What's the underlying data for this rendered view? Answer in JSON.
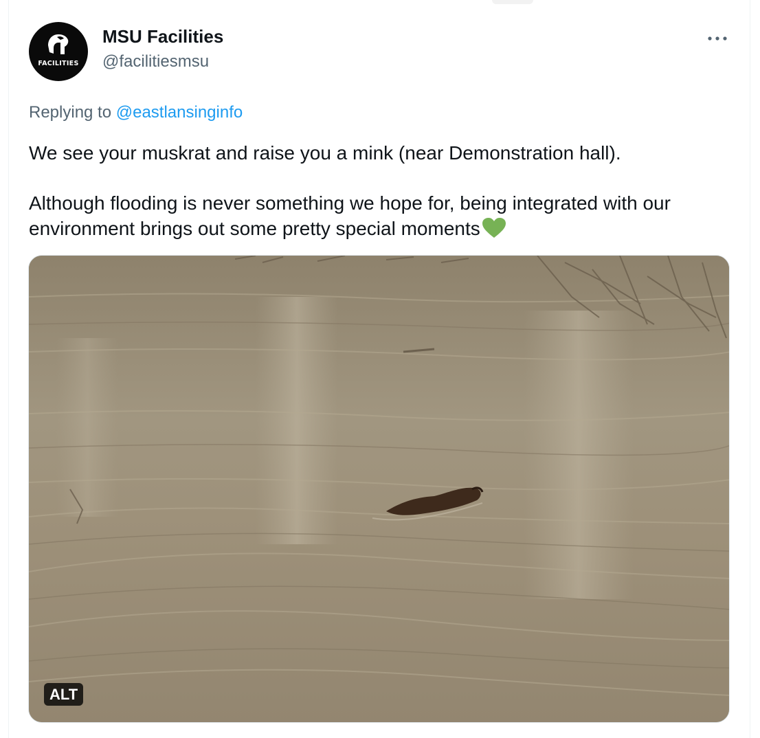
{
  "tweet": {
    "author": {
      "display_name": "MSU Facilities",
      "handle": "@facilitiesmsu",
      "avatar_text": "FACILITIES"
    },
    "more_icon": "more-dots-icon",
    "reply": {
      "prefix": "Replying to ",
      "to": "@eastlansinginfo"
    },
    "text_paragraphs": [
      "We see your muskrat and raise you a mink (near Demonstration hall).",
      "Although flooding is never something we hope for, being integrated with our environment brings out some pretty special moments"
    ],
    "emoji": "green-heart-icon",
    "media": {
      "alt_badge": "ALT"
    }
  },
  "colors": {
    "link": "#1d9bf0",
    "secondary_text": "#536471",
    "primary_text": "#0f1419",
    "heart": "#77b255"
  }
}
